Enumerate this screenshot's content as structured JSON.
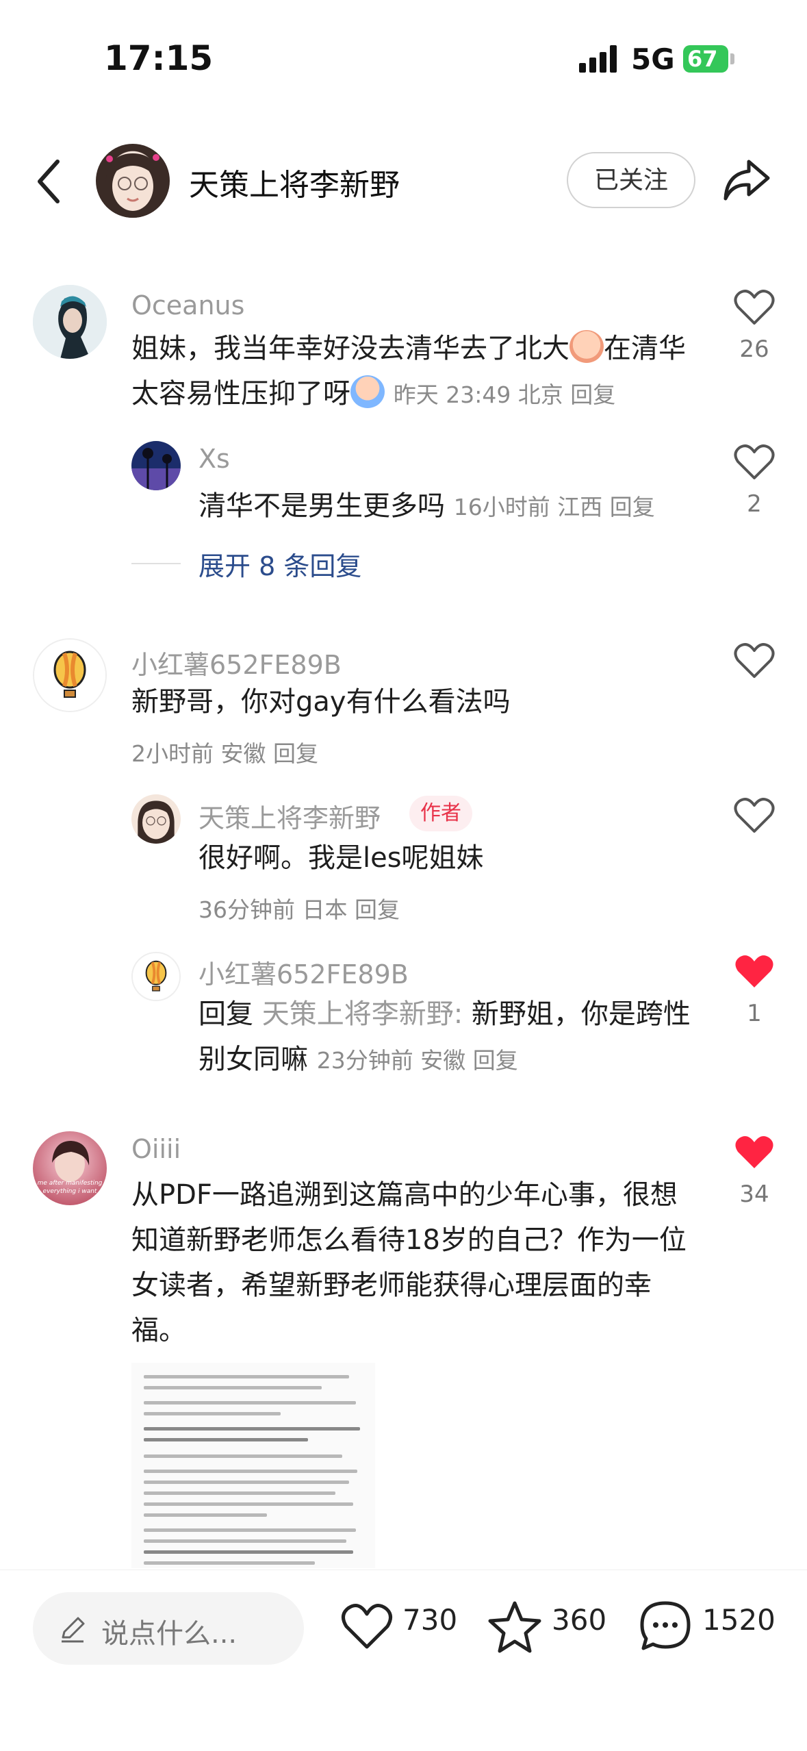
{
  "status_bar": {
    "time": "17:15",
    "network": "5G",
    "battery": "67"
  },
  "header": {
    "name": "天策上将李新野",
    "follow_label": "已关注"
  },
  "comments": [
    {
      "user": "Oceanus",
      "text_a": "姐妹，我当年幸好没去清华去了北大",
      "text_b": "在清华太容易性压抑了呀",
      "meta": "昨天 23:49 北京 回复",
      "likes": "26",
      "replies": [
        {
          "user": "Xs",
          "text": "清华不是男生更多吗",
          "meta": "16小时前 江西 回复",
          "likes": "2"
        }
      ],
      "expand_label": "展开 8 条回复"
    },
    {
      "user": "小红薯652FE89B",
      "text": "新野哥，你对gay有什么看法吗",
      "meta": "2小时前 安徽 回复",
      "replies": [
        {
          "user": "天策上将李新野",
          "tag": "作者",
          "text": "很好啊。我是les呢姐妹",
          "meta": "36分钟前 日本 回复"
        },
        {
          "user": "小红薯652FE89B",
          "reply_prefix": "回复",
          "reply_to": "天策上将李新野:",
          "text": "新野姐，你是跨性别女同嘛",
          "meta": "23分钟前 安徽 回复",
          "likes": "1"
        }
      ]
    },
    {
      "user": "Oiiii",
      "text": "从PDF一路追溯到这篇高中的少年心事，很想知道新野老师怎么看待18岁的自己？作为一位女读者，希望新野老师能获得心理层面的幸福。",
      "likes": "34",
      "avatar_caption": "me after manifesting everything i want"
    }
  ],
  "bottom_bar": {
    "input_placeholder": "说点什么...",
    "likes": "730",
    "stars": "360",
    "comments": "1520"
  },
  "colors": {
    "liked_red": "#ff2442",
    "link_blue": "#2b4c8c",
    "battery_green": "#34c759",
    "author_tag_red": "#e8334a"
  }
}
